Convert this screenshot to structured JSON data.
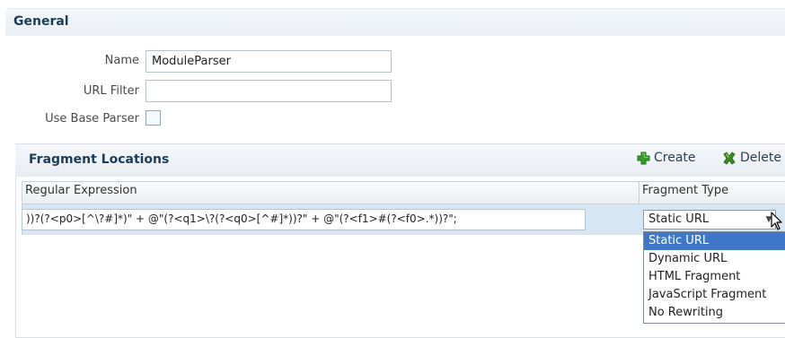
{
  "general": {
    "title": "General",
    "name_label": "Name",
    "name_value": "ModuleParser",
    "url_filter_label": "URL Filter",
    "url_filter_value": "",
    "use_base_parser_label": "Use Base Parser"
  },
  "fragments": {
    "title": "Fragment Locations",
    "create_label": "Create",
    "delete_label": "Delete",
    "columns": [
      "Regular Expression",
      "Fragment Type"
    ],
    "rows": [
      {
        "regex": "))?(?<p0>[^\\?#]*)\" + @\"(?<q1>\\?(?<q0>[^#]*))?\" + @\"(?<f1>#(?<f0>.*))?\";",
        "type": "Static URL"
      }
    ],
    "type_options": [
      "Static URL",
      "Dynamic URL",
      "HTML Fragment",
      "JavaScript Fragment",
      "No Rewriting"
    ]
  },
  "colors": {
    "section_title": "#1b3d5c",
    "selected_row": "#d7e6f4",
    "selected_option": "#3f78c8",
    "create_icon": "#3a9a2a",
    "delete_icon": "#3a8a22"
  },
  "icons": {
    "create": "plus-icon",
    "delete": "x-icon"
  }
}
